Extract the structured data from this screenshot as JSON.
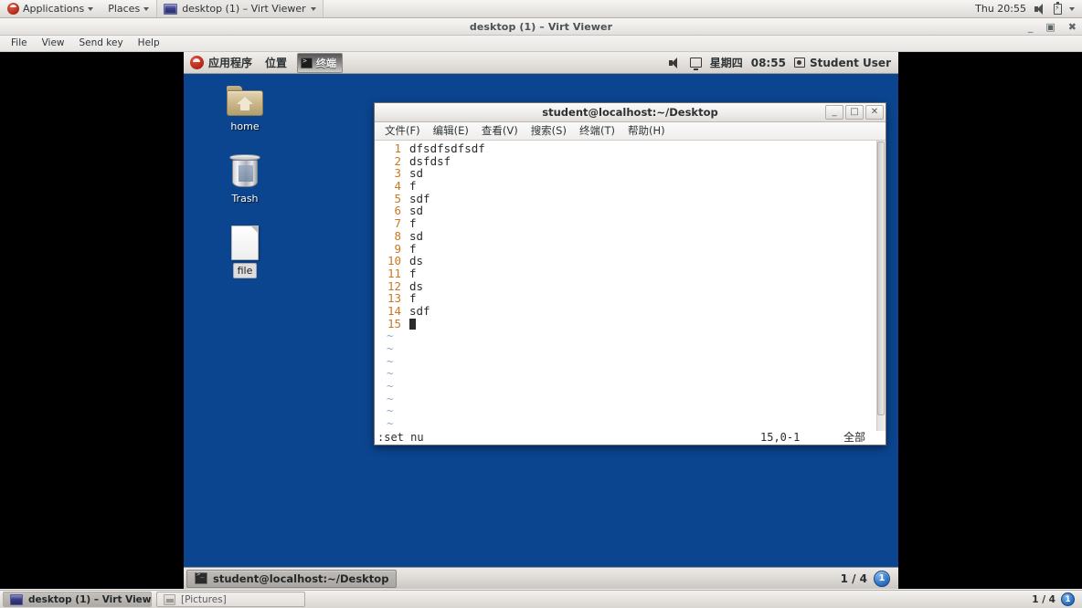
{
  "host": {
    "top_panel": {
      "applications_label": "Applications",
      "places_label": "Places",
      "window_switcher_label": "desktop (1) – Virt Viewer",
      "clock": "Thu 20:55"
    },
    "taskbar": {
      "items": [
        {
          "label": "desktop (1) – Virt Viewer",
          "icon": "screen-icon",
          "active": true
        },
        {
          "label": "[Pictures]",
          "icon": "picture-icon",
          "active": false
        }
      ],
      "workspace_text": "1 / 4",
      "workspace_current": "1"
    }
  },
  "virt_viewer": {
    "title": "desktop (1) – Virt Viewer",
    "menus": [
      "File",
      "View",
      "Send key",
      "Help"
    ],
    "window_buttons": {
      "minimize": "_",
      "restore": "▣",
      "close": "✖"
    }
  },
  "guest": {
    "top_panel": {
      "applications_label": "应用程序",
      "places_label": "位置",
      "window_button_label": "终端",
      "clock_day": "星期四",
      "clock_time": "08:55",
      "user_label": "Student User"
    },
    "desktop_icons": [
      {
        "label": "home",
        "icon": "home-folder-icon",
        "selected": false
      },
      {
        "label": "Trash",
        "icon": "trash-icon",
        "selected": false
      },
      {
        "label": "file",
        "icon": "document-icon",
        "selected": true
      }
    ],
    "bottom_panel": {
      "task_label": "student@localhost:~/Desktop",
      "workspace_text": "1 / 4",
      "workspace_current": "1"
    }
  },
  "terminal": {
    "title": "student@localhost:~/Desktop",
    "menus": [
      "文件(F)",
      "编辑(E)",
      "查看(V)",
      "搜索(S)",
      "终端(T)",
      "帮助(H)"
    ],
    "window_buttons": {
      "minimize": "_",
      "maximize": "□",
      "close": "✕"
    },
    "vim": {
      "lines": [
        {
          "n": "1",
          "text": "dfsdfsdfsdf"
        },
        {
          "n": "2",
          "text": "dsfdsf"
        },
        {
          "n": "3",
          "text": "sd"
        },
        {
          "n": "4",
          "text": "f"
        },
        {
          "n": "5",
          "text": "sdf"
        },
        {
          "n": "6",
          "text": "sd"
        },
        {
          "n": "7",
          "text": "f"
        },
        {
          "n": "8",
          "text": "sd"
        },
        {
          "n": "9",
          "text": "f"
        },
        {
          "n": "10",
          "text": "ds"
        },
        {
          "n": "11",
          "text": "f"
        },
        {
          "n": "12",
          "text": "ds"
        },
        {
          "n": "13",
          "text": "f"
        },
        {
          "n": "14",
          "text": "sdf"
        },
        {
          "n": "15",
          "text": ""
        }
      ],
      "empty_marker": "~",
      "empty_count": 8,
      "command_line": ":set nu",
      "ruler": "15,0-1",
      "file_position": "全部",
      "linenumber_color": "#cc7722"
    }
  }
}
